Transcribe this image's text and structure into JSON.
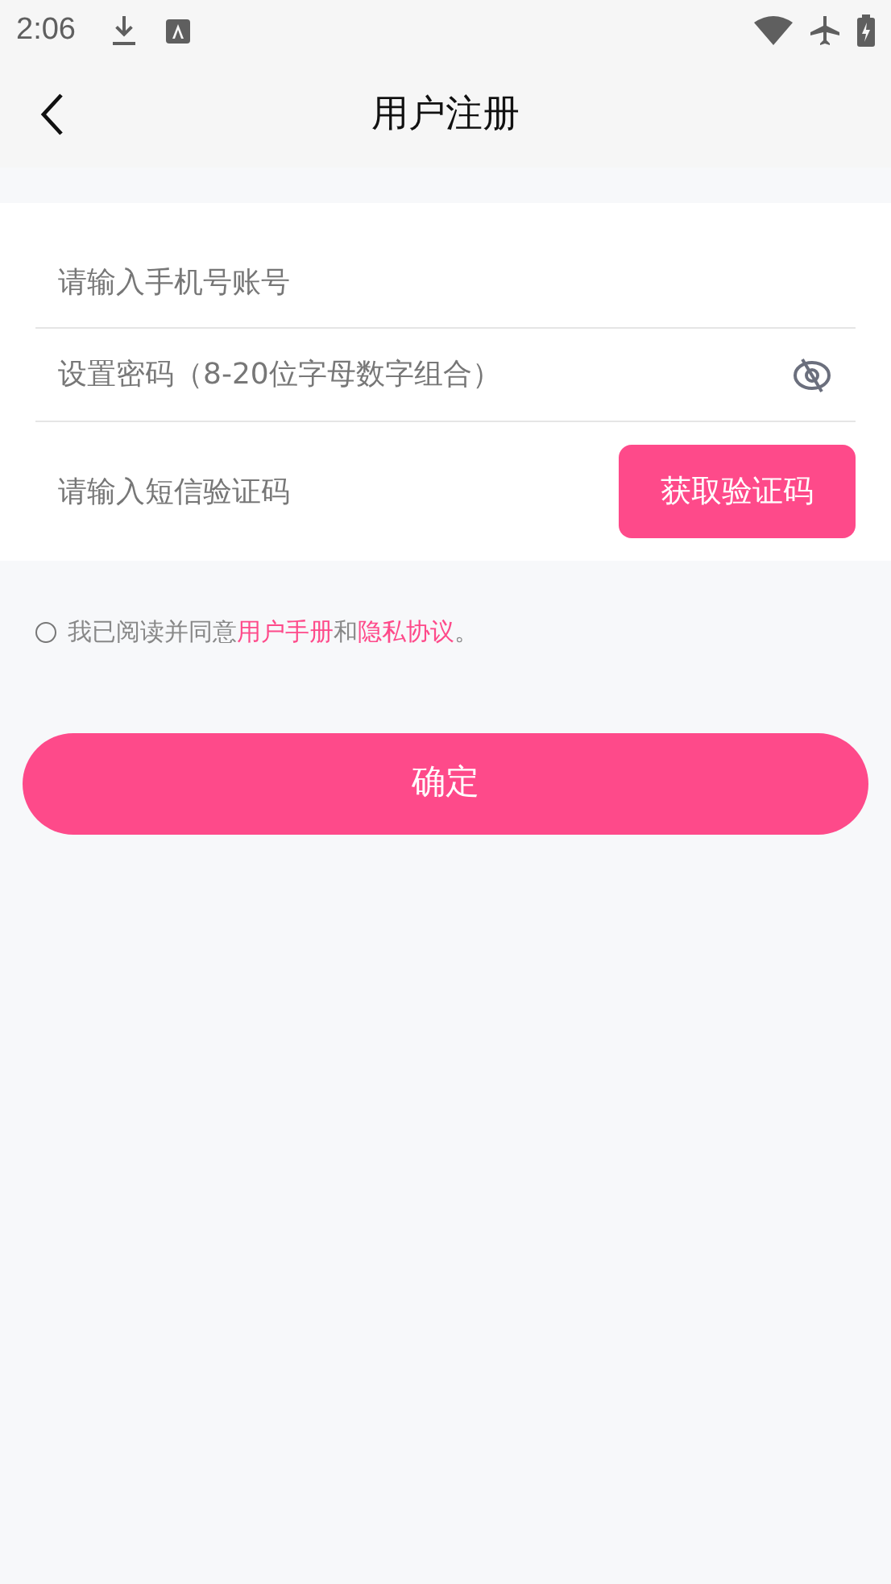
{
  "status_bar": {
    "time": "2:06"
  },
  "header": {
    "title": "用户注册"
  },
  "form": {
    "phone": {
      "placeholder": "请输入手机号账号"
    },
    "password": {
      "placeholder": "设置密码（8-20位字母数字组合）",
      "visible": false
    },
    "code": {
      "placeholder": "请输入短信验证码",
      "button": "获取验证码"
    }
  },
  "agreement": {
    "checked": false,
    "prefix": "我已阅读并同意",
    "link_1": "用户手册",
    "middle": "和",
    "link_2": "隐私协议",
    "suffix": "。"
  },
  "submit": "确定"
}
